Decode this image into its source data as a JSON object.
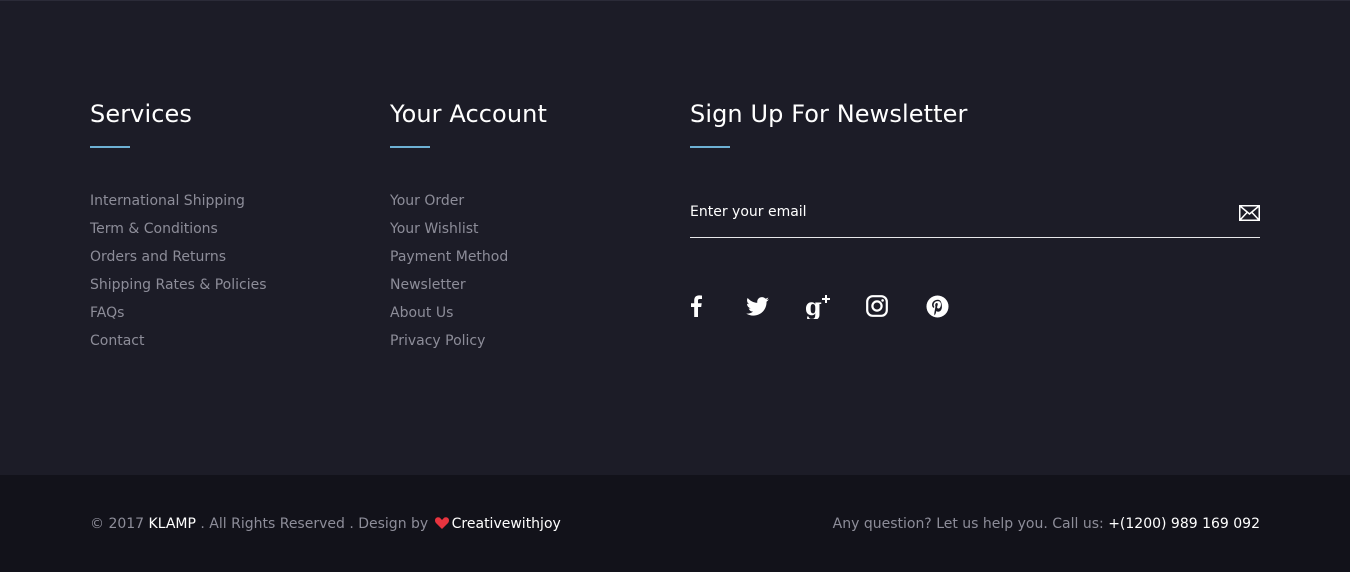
{
  "services": {
    "title": "Services",
    "links": [
      "International Shipping",
      "Term & Conditions",
      "Orders and Returns",
      "Shipping Rates & Policies",
      "FAQs",
      "Contact"
    ]
  },
  "account": {
    "title": "Your Account",
    "links": [
      "Your Order",
      "Your Wishlist",
      "Payment Method",
      "Newsletter",
      "About Us",
      "Privacy Policy"
    ]
  },
  "newsletter": {
    "title": "Sign Up For Newsletter",
    "email_placeholder": "Enter your email",
    "email_value": "",
    "submit_icon": "envelope-icon"
  },
  "socials": [
    {
      "icon": "facebook-icon"
    },
    {
      "icon": "twitter-icon"
    },
    {
      "icon": "google-plus-icon"
    },
    {
      "icon": "instagram-icon"
    },
    {
      "icon": "pinterest-icon"
    }
  ],
  "bottom": {
    "copyright_prefix": "© 2017",
    "brand": "KLAMP",
    "rights": ". All Rights Reserved . Design by",
    "heart_icon": "heart-icon",
    "designer": "Creativewithjoy",
    "contact_text": "Any question? Let us help you. Call us:",
    "phone": "+(1200) 989 169 092"
  },
  "colors": {
    "background": "#1c1c27",
    "bottom_bar": "#12121a",
    "accent_underline": "#6db0d4",
    "link_text": "#8d8d99",
    "heart": "#e8343f"
  }
}
